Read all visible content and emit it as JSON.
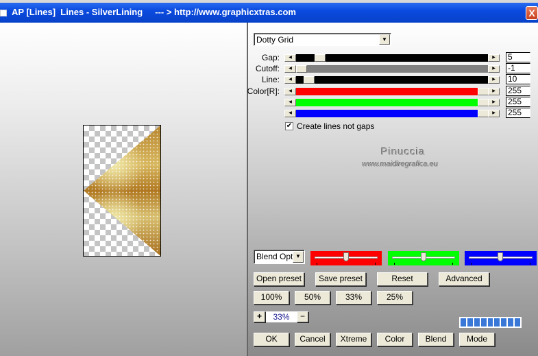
{
  "window": {
    "title": "AP [Lines]  Lines - SilverLining     --- > http://www.graphicxtras.com",
    "close": "X"
  },
  "preset_dropdown": {
    "value": "Dotty Grid"
  },
  "sliders": [
    {
      "label": "Gap:",
      "value": "5",
      "color": "#000000",
      "thumb_pos": 0.1
    },
    {
      "label": "Cutoff:",
      "value": "-1",
      "color": "#808080",
      "thumb_pos": 0.0
    },
    {
      "label": "Line:",
      "value": "10",
      "color": "#000000",
      "thumb_pos": 0.04
    },
    {
      "label": "Color[R]:",
      "value": "255",
      "color": "#ff0000",
      "thumb_pos": 1.0
    },
    {
      "label": "",
      "value": "255",
      "color": "#00ff00",
      "thumb_pos": 1.0
    },
    {
      "label": "",
      "value": "255",
      "color": "#0000ff",
      "thumb_pos": 1.0
    }
  ],
  "checkbox": {
    "label": "Create lines not gaps",
    "checked": true
  },
  "watermark": {
    "name": "Pinuccia",
    "url": "www.maidiregrafica.eu"
  },
  "blend_dropdown": {
    "value": "Blend Opti"
  },
  "color_sliders": [
    {
      "color": "#ff0000",
      "pos": 0.5
    },
    {
      "color": "#00ff00",
      "pos": 0.5
    },
    {
      "color": "#0000ff",
      "pos": 0.5
    }
  ],
  "preset_buttons": [
    "Open preset",
    "Save preset",
    "Reset",
    "Advanced"
  ],
  "zoom_buttons": [
    "100%",
    "50%",
    "33%",
    "25%"
  ],
  "zoom": {
    "plus": "+",
    "value": "33%",
    "minus": "−"
  },
  "progress": {
    "segments": 9,
    "fraction": 1.0
  },
  "bottom_buttons": [
    "OK",
    "Cancel",
    "Xtreme",
    "Color",
    "Blend",
    "Mode"
  ]
}
